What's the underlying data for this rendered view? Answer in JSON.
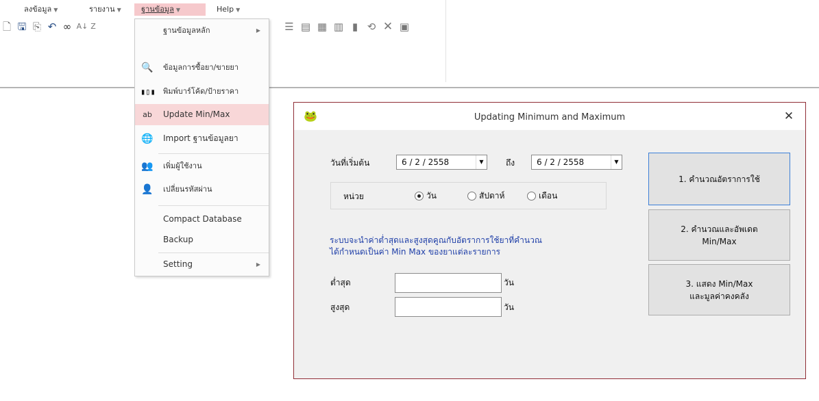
{
  "menu": {
    "items": [
      {
        "label": "ลงข้อมูล"
      },
      {
        "label": "รายงาน"
      },
      {
        "label": "ฐานข้อมูล",
        "active": true
      },
      {
        "label": "Help"
      }
    ]
  },
  "toolbar": {
    "icons": [
      "new-document-icon",
      "save-icon",
      "print-preview-icon",
      "undo-icon",
      "binoculars-icon",
      "sort-ascending-icon",
      "sort-descending-icon"
    ],
    "right_icons": [
      "insert-row-icon",
      "form-icon",
      "insert-column-icon",
      "insert-column-2-icon",
      "chart-icon",
      "refresh-icon",
      "delete-icon",
      "export-excel-icon"
    ]
  },
  "dropdown": {
    "items": [
      {
        "label": "ฐานข้อมูลหลัก",
        "icon": "",
        "submenu": true
      },
      {
        "label": "ข้อมูลการซื้อยา/ขายยา",
        "icon": "magnifier-icon"
      },
      {
        "label": "พิมพ์บาร์โค้ด/ป้ายราคา",
        "icon": "barcode-icon"
      },
      {
        "label": "Update Min/Max",
        "icon": "spellcheck-icon",
        "highlighted": true
      },
      {
        "label": "Import ฐานข้อมูลยา",
        "icon": "globe-import-icon"
      },
      {
        "label": "เพิ่มผู้ใช้งาน",
        "icon": "users-icon"
      },
      {
        "label": "เปลี่ยนรหัสผ่าน",
        "icon": "user-key-icon"
      },
      {
        "label": "Compact Database",
        "icon": ""
      },
      {
        "label": "Backup",
        "icon": ""
      },
      {
        "label": "Setting",
        "icon": "",
        "submenu": true
      }
    ]
  },
  "dialog": {
    "title": "Updating Minimum and Maximum",
    "icon": "frog-app-icon",
    "close_glyph": "✕",
    "start_date_label": "วันที่เริ่มต้น",
    "start_date_value": "6 / 2 / 2558",
    "to_label": "ถึง",
    "end_date_value": "6 / 2 / 2558",
    "unit_label": "หน่วย",
    "unit_options": [
      {
        "label": "วัน",
        "selected": true
      },
      {
        "label": "สัปดาห์",
        "selected": false
      },
      {
        "label": "เดือน",
        "selected": false
      }
    ],
    "info_lines": [
      "ระบบจะนำค่าต่ำสุดและสูงสุดคูณกับอัตราการใช้ยาที่คำนวณ",
      "ได้กำหนดเป็นค่า Min Max ของยาแต่ละรายการ"
    ],
    "min_label": "ต่ำสุด",
    "min_value": "",
    "max_label": "สูงสุด",
    "max_value": "",
    "unit_suffix": "วัน",
    "buttons": [
      {
        "lines": [
          "1. คำนวณอัตราการใช้"
        ]
      },
      {
        "lines": [
          "2. คำนวณและอัพเดต",
          "Min/Max"
        ]
      },
      {
        "lines": [
          "3. แสดง Min/Max",
          "และมูลค่าคงคลัง"
        ]
      }
    ],
    "accent_color": "#1f3fa8",
    "border_color": "#8f2c35"
  }
}
